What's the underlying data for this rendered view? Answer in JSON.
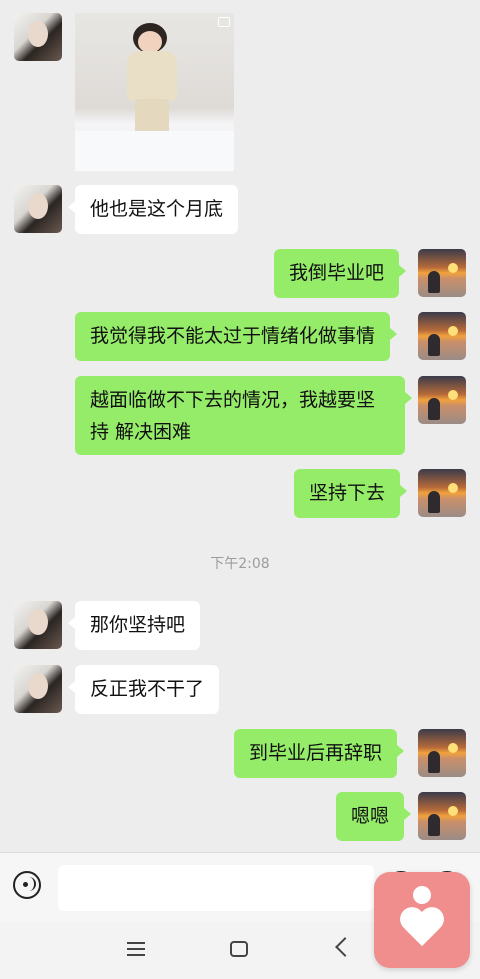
{
  "chat": {
    "messages": [
      {
        "id": "m1",
        "side": "left",
        "text": "他也是这个月底"
      },
      {
        "id": "m2",
        "side": "right",
        "text": "我倒毕业吧"
      },
      {
        "id": "m3",
        "side": "right",
        "text": "我觉得我不能太过于情绪化做事情"
      },
      {
        "id": "m4",
        "side": "right",
        "text": "越面临做不下去的情况，我越要坚持 解决困难"
      },
      {
        "id": "m5",
        "side": "right",
        "text": "坚持下去"
      },
      {
        "id": "m6",
        "side": "left",
        "text": "那你坚持吧"
      },
      {
        "id": "m7",
        "side": "left",
        "text": "反正我不干了"
      },
      {
        "id": "m8",
        "side": "right",
        "text": "到毕业后再辞职"
      },
      {
        "id": "m9",
        "side": "right",
        "text": "嗯嗯"
      }
    ],
    "timestamp": "下午2:08"
  },
  "input": {
    "value": ""
  },
  "icons": {
    "voice": "voice-icon",
    "emoji": "emoji-icon",
    "plus": "plus-icon",
    "menu": "menu-icon",
    "home": "home-icon",
    "back": "back-icon",
    "floating_app": "heart-app-icon"
  },
  "colors": {
    "sent_bubble": "#95ec69",
    "received_bubble": "#ffffff",
    "background": "#ededed",
    "floating_app": "#f08d8d"
  }
}
